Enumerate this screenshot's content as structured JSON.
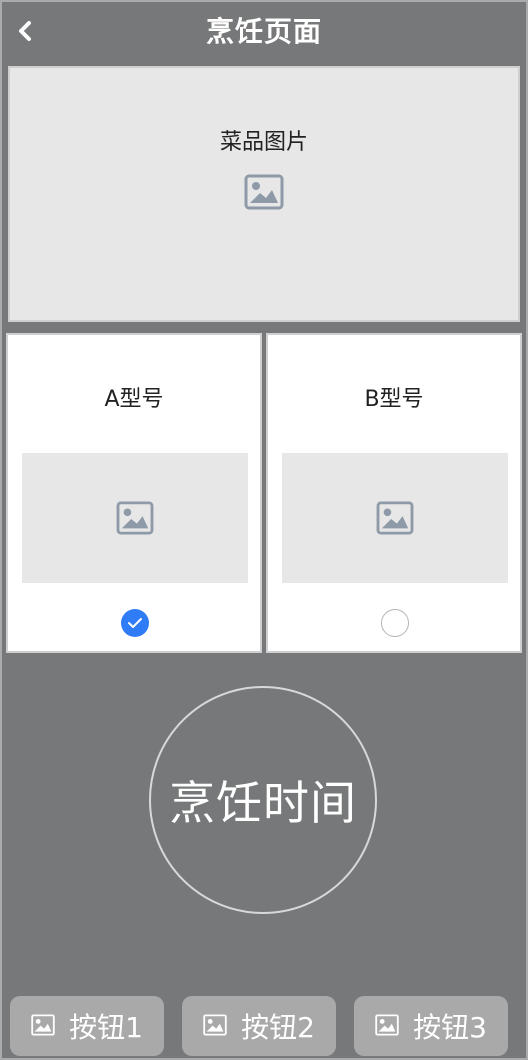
{
  "header": {
    "title": "烹饪页面",
    "back_icon": "chevron-left-icon"
  },
  "banner": {
    "label": "菜品图片",
    "icon": "image-icon"
  },
  "options": [
    {
      "label": "A型号",
      "icon": "image-icon",
      "selected": true
    },
    {
      "label": "B型号",
      "icon": "image-icon",
      "selected": false
    }
  ],
  "timer": {
    "label": "烹饪时间"
  },
  "buttons": [
    {
      "label": "按钮1",
      "icon": "image-icon"
    },
    {
      "label": "按钮2",
      "icon": "image-icon"
    },
    {
      "label": "按钮3",
      "icon": "image-icon"
    }
  ],
  "colors": {
    "background": "#777879",
    "panel": "#e7e7e7",
    "card": "#ffffff",
    "accent": "#2f7cf6",
    "button": "#a9a9aa"
  }
}
